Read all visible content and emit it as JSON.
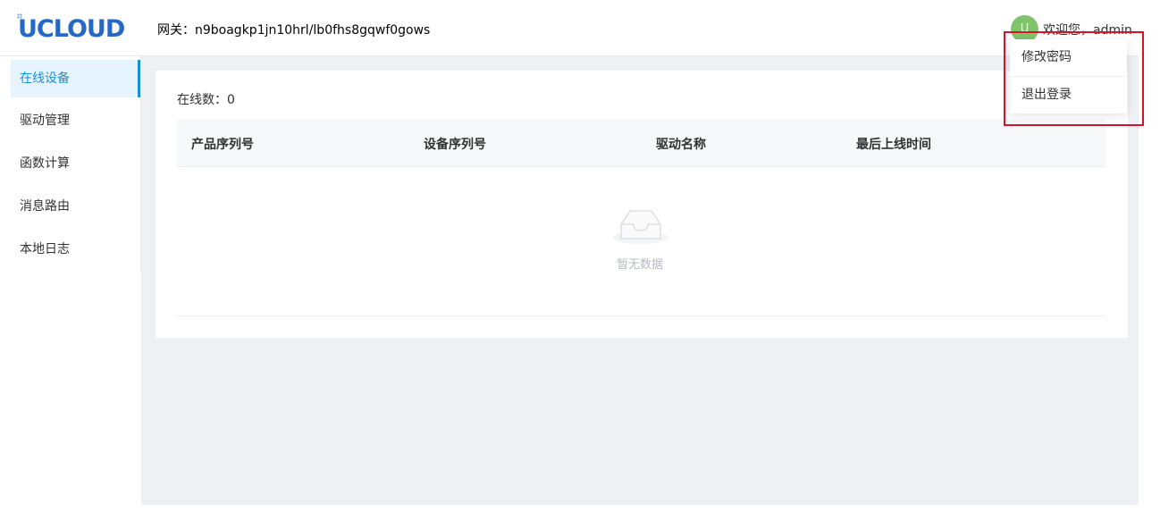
{
  "header": {
    "logo": "UCLOUD",
    "gateway": "网关：n9boagkp1jn10hrl/lb0fhs8gqwf0gows",
    "avatar_initial": "U",
    "welcome": "欢迎您，admin"
  },
  "sidebar": {
    "items": [
      {
        "label": "在线设备"
      },
      {
        "label": "驱动管理"
      },
      {
        "label": "函数计算"
      },
      {
        "label": "消息路由"
      },
      {
        "label": "本地日志"
      }
    ]
  },
  "main": {
    "online_count": "在线数：0",
    "columns": [
      "产品序列号",
      "设备序列号",
      "驱动名称",
      "最后上线时间"
    ],
    "empty_text": "暂无数据"
  },
  "dropdown": {
    "items": [
      {
        "label": "修改密码"
      },
      {
        "label": "退出登录"
      }
    ]
  },
  "colors": {
    "brand": "#2468c9",
    "active": "#1890d6",
    "avatar": "#7fc46b",
    "highlight": "#d9122a"
  }
}
